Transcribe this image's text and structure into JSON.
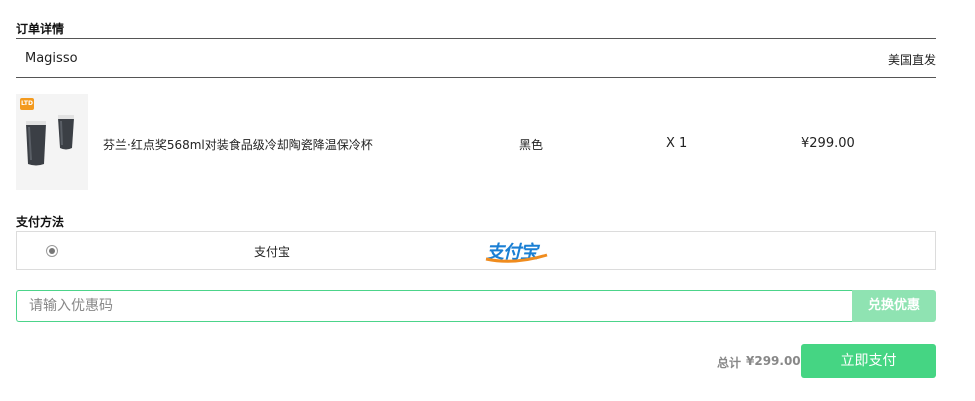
{
  "order": {
    "section_title": "订单详情",
    "shop_name": "Magisso",
    "shipping": "美国直发",
    "item": {
      "badge": "LTD",
      "name": "芬兰·红点奖568ml对装食品级冷却陶瓷降温保冷杯",
      "color": "黑色",
      "quantity": "X 1",
      "price": "¥299.00"
    }
  },
  "payment": {
    "section_title": "支付方法",
    "method_label": "支付宝",
    "logo_text": "支付宝",
    "selected": true
  },
  "coupon": {
    "placeholder": "请输入优惠码",
    "button_label": "兑换优惠"
  },
  "summary": {
    "total_label": "总计",
    "total_value": "¥299.00",
    "pay_button": "立即支付"
  },
  "colors": {
    "accent": "#45d583",
    "accent_light": "#8fe3b2",
    "alipay_blue": "#1a7fd4",
    "alipay_orange": "#f08c1e"
  }
}
